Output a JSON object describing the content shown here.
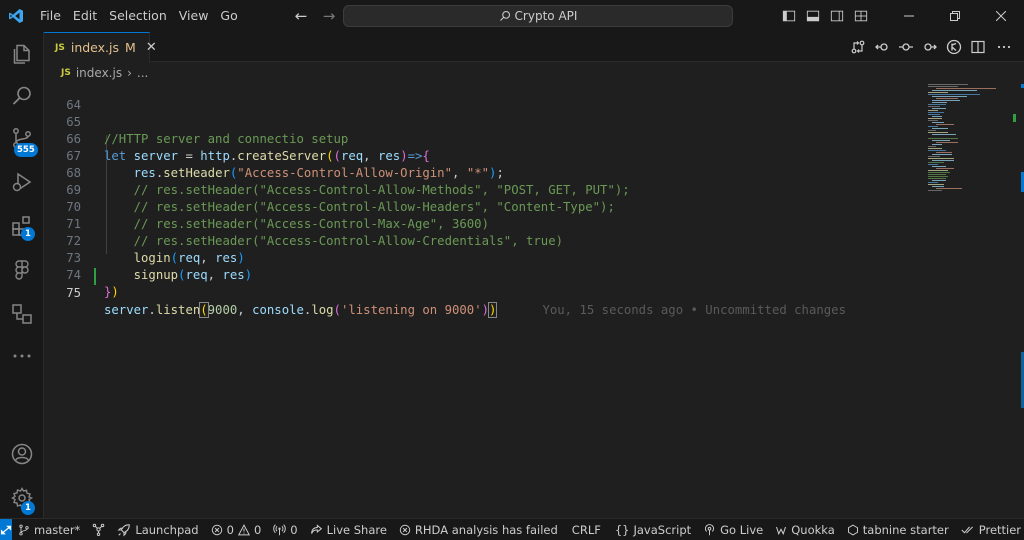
{
  "titlebar": {
    "menu": [
      "File",
      "Edit",
      "Selection",
      "View",
      "Go"
    ],
    "command_center": "Crypto API",
    "back_icon": "arrow-left",
    "forward_icon": "arrow-right"
  },
  "activity_bar": {
    "items": [
      {
        "name": "explorer",
        "icon": "files-icon"
      },
      {
        "name": "search",
        "icon": "search-icon"
      },
      {
        "name": "source-control",
        "icon": "git-branch-icon",
        "badge": "555"
      },
      {
        "name": "run-debug",
        "icon": "debug-icon"
      },
      {
        "name": "extensions",
        "icon": "extensions-icon",
        "badge": "1"
      },
      {
        "name": "figma",
        "icon": "figma-icon"
      },
      {
        "name": "remote-explorer",
        "icon": "remote-explorer-icon"
      },
      {
        "name": "more",
        "icon": "ellipsis-icon"
      }
    ],
    "accounts_icon": "account-icon",
    "manage_icon": "gear-icon",
    "manage_badge": "1"
  },
  "tabs": [
    {
      "label": "index.js",
      "lang_badge": "JS",
      "modified": "M",
      "active": true
    }
  ],
  "breadcrumb": {
    "file": "index.js",
    "lang_badge": "JS",
    "more": "..."
  },
  "editor": {
    "active_line": 75,
    "lines": [
      {
        "n": "64"
      },
      {
        "n": "65"
      },
      {
        "n": "66"
      },
      {
        "n": "67"
      },
      {
        "n": "68"
      },
      {
        "n": "69"
      },
      {
        "n": "70"
      },
      {
        "n": "71"
      },
      {
        "n": "72"
      },
      {
        "n": "73"
      },
      {
        "n": "74"
      },
      {
        "n": "75"
      }
    ],
    "code": {
      "l65_comment": "//HTTP server and connectio setup",
      "l66_let": "let",
      "l66_server": "server",
      "l66_eq": " = ",
      "l66_http": "http",
      "l66_create": "createServer",
      "l66_req": "req",
      "l66_res": "res",
      "l66_arrow": "=>",
      "l67_res": "res",
      "l67_fn": "setHeader",
      "l67_s1": "\"Access-Control-Allow-Origin\"",
      "l67_s2": "\"*\"",
      "l68": "// res.setHeader(\"Access-Control-Allow-Methods\", \"POST, GET, PUT\");",
      "l69": "// res.setHeader(\"Access-Control-Allow-Headers\", \"Content-Type\");",
      "l70": "// res.setHeader(\"Access-Control-Max-Age\", 3600)",
      "l71": "// res.setHeader(\"Access-Control-Allow-Credentials\", true)",
      "l72_fn": "login",
      "l72_req": "req",
      "l72_res": "res",
      "l73_fn": "signup",
      "l73_req": "req",
      "l73_res": "res",
      "l75_server": "server",
      "l75_listen": "listen",
      "l75_num": "9000",
      "l75_console": "console",
      "l75_log": "log",
      "l75_str": "'listening on 9000'"
    },
    "blame": "You, 15 seconds ago • Uncommitted changes"
  },
  "statusbar": {
    "branch": "master*",
    "launchpad": "Launchpad",
    "errors": "0",
    "warnings": "0",
    "ports": "0",
    "live_share": "Live Share",
    "rhda": "RHDA analysis has failed",
    "eol": "CRLF",
    "language": "JavaScript",
    "go_live": "Go Live",
    "quokka": "Quokka",
    "tabnine": "tabnine starter",
    "prettier": "Prettier"
  },
  "colors": {
    "accent": "#0078d4",
    "git_added": "#2ea043",
    "modified_tab": "#e2c08d"
  }
}
